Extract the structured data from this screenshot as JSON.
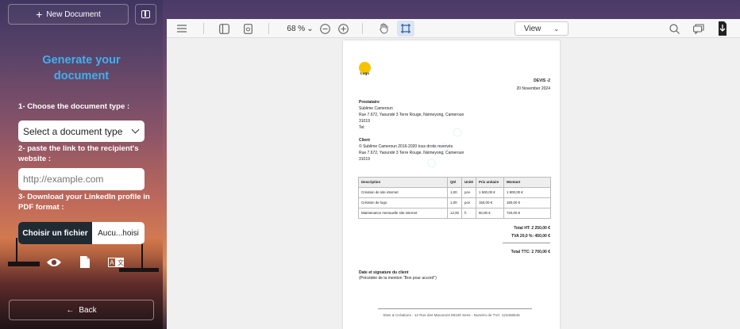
{
  "sidebar": {
    "new_document_label": "New Document",
    "title": "Generate your document",
    "step1_label": "1- Choose the document type :",
    "doc_type_selected": "Select a document type",
    "step2_label": "2- paste the link to the recipient's website :",
    "url_placeholder": "http://example.com",
    "step3_label": "3- Download your LinkedIn profile in PDF format :",
    "file_button_label": "Choisir un fichier",
    "file_name": "Aucu...hoisi",
    "back_label": "Back"
  },
  "toolbar": {
    "zoom": "68 %",
    "view_label": "View"
  },
  "document": {
    "logo_text": "Logo",
    "doc_title": "DEVIS -2",
    "doc_date": "20 November 2024",
    "prestataire_label": "Prestataire",
    "prestataire_lines": [
      "Sublime Cameroun",
      "Rue 7.672, Yaoundé 3 Terre Rouge, Nsimeyong, Cameroun",
      "31019",
      "Tel:"
    ],
    "client_label": "Client",
    "client_lines": [
      "© Sublime Cameroun 2016-2020 tous droits reservés",
      "Rue 7.672, Yaoundé 3 Terre Rouge, Nsimeyong, Cameroun",
      "31019"
    ],
    "table_headers": [
      "Description",
      "Qté",
      "Unité",
      "Prix unitaire",
      "Montant"
    ],
    "table_rows": [
      [
        "Création de site internet",
        "1,00",
        "pce",
        "1 500,00 €",
        "1 800,00 €"
      ],
      [
        "Création de logo",
        "1,00",
        "pce",
        "150,00 €",
        "180,00 €"
      ],
      [
        "Maintenance mensuelle site internet",
        "12,00",
        "h",
        "50,00 €",
        "720,00 €"
      ]
    ],
    "total_ht": "Total HT: 2 250,00 €",
    "tva": "TVA 20,0 %: 450,00 €",
    "total_ttc": "Total TTC: 2 700,00 €",
    "signature_label": "Date et signature du client",
    "signature_note": "(Précédée de la mention \"Bon pour accord\")",
    "footer": "Sites & Créations - 12 Rue des Macarons 89100 Sens - Numéro de TVA: 123456545"
  }
}
